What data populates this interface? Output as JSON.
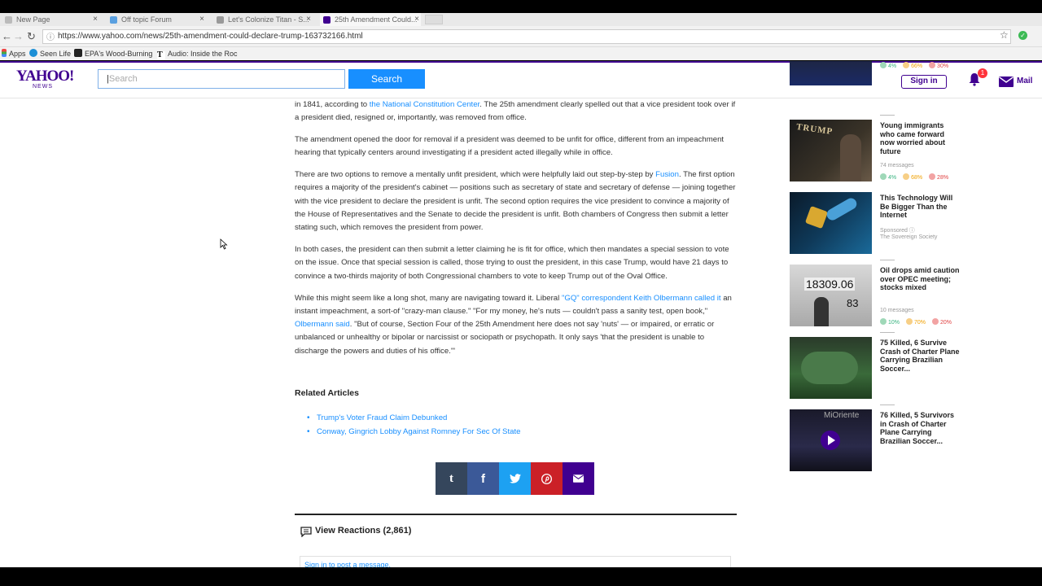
{
  "tabs": [
    {
      "title": "New Page",
      "color": "#bbbbbb"
    },
    {
      "title": "Off topic Forum",
      "color": "#5aa0e0"
    },
    {
      "title": "Let's Colonize Titan - S...",
      "color": "#999999"
    },
    {
      "title": "25th Amendment Could...",
      "color": "#400090"
    }
  ],
  "url": "https://www.yahoo.com/news/25th-amendment-could-declare-trump-163732166.html",
  "bookmarks": [
    "Apps",
    "Seen Life",
    "EPA's Wood-Burning",
    "Audio: Inside the Roc"
  ],
  "header": {
    "logo": "YAHOO!",
    "logo_sub": "NEWS",
    "search_placeholder": "Search",
    "search_button": "Search",
    "signin": "Sign in",
    "notifications": "1",
    "mail": "Mail"
  },
  "article": {
    "p1_a": "in 1841, according to ",
    "p1_link": "the National Constitution Center",
    "p1_b": ". The 25th amendment clearly spelled out that a vice president took over if a president died, resigned or, importantly, was removed from office.",
    "p2": "The amendment opened the door for removal if a president was deemed to be unfit for office, different from an impeachment hearing that typically centers around investigating if a president acted illegally while in office.",
    "p3_a": "There are two options to remove a mentally unfit president, which were helpfully laid out step-by-step by ",
    "p3_link": "Fusion",
    "p3_b": ". The first option requires a majority of the president's cabinet — positions such as secretary of state and secretary of defense — joining together with the vice president to declare the president is unfit. The second option requires the vice president to convince a majority of the House of Representatives and the Senate to decide the president is unfit. Both chambers of Congress then submit a letter stating such, which removes the president from power.",
    "p4": "In both cases, the president can then submit a letter claiming he is fit for office, which then mandates a special session to vote on the issue. Once that special session is called, those trying to oust the president, in this case Trump, would have 21 days to convince a two-thirds majority of both Congressional chambers to vote to keep Trump out of the Oval Office.",
    "p5_a": "While this might seem like a long shot, many are navigating toward it. Liberal ",
    "p5_link1": "\"GQ\" correspondent Keith Olbermann called it",
    "p5_b": " an instant impeachment, a sort-of \"crazy-man clause.\" \"For my money, he's nuts — couldn't pass a sanity test, open book,\" ",
    "p5_link2": "Olbermann said",
    "p5_c": ". \"But of course, Section Four of the 25th Amendment here does not say 'nuts' — or impaired, or erratic or unbalanced or unhealthy or bipolar or narcissist or sociopath or psychopath. It only says 'that the president is unable to discharge the powers and duties of his office.'\""
  },
  "related": {
    "title": "Related Articles",
    "items": [
      "Trump's Voter Fraud Claim Debunked",
      "Conway, Gingrich Lobby Against Romney For Sec Of State"
    ]
  },
  "share": [
    {
      "icon": "tumblr-icon",
      "glyph": "t",
      "color": "#35465c"
    },
    {
      "icon": "facebook-icon",
      "glyph": "f",
      "color": "#3b5998"
    },
    {
      "icon": "twitter-icon",
      "glyph": "",
      "color": "#1da1f2"
    },
    {
      "icon": "pinterest-icon",
      "glyph": "",
      "color": "#cb2027"
    },
    {
      "icon": "mail-icon",
      "glyph": "",
      "color": "#400090"
    }
  ],
  "reactions": {
    "label": "View Reactions (2,861)",
    "signin_prompt": "Sign in to post a message."
  },
  "sidebar": [
    {
      "title": "",
      "meta": "",
      "rx": [
        "4%",
        "66%",
        "30%"
      ]
    },
    {
      "title": "Young immigrants who came forward now worried about future",
      "meta": "74 messages",
      "rx": [
        "4%",
        "68%",
        "28%"
      ]
    },
    {
      "title": "This Technology Will Be Bigger Than the Internet",
      "meta": "Sponsored",
      "sponsor": "The Sovereign Society",
      "rx": []
    },
    {
      "title": "Oil drops amid caution over OPEC meeting; stocks mixed",
      "meta": "10 messages",
      "rx": [
        "10%",
        "70%",
        "20%"
      ],
      "thumb_text1": "18309.06",
      "thumb_text2": "83"
    },
    {
      "title": "75 Killed, 6 Survive Crash of Charter Plane Carrying Brazilian Soccer...",
      "meta": "",
      "rx": []
    },
    {
      "title": "76 Killed, 5 Survivors in Crash of Charter Plane Carrying Brazilian Soccer...",
      "meta": "",
      "rx": [],
      "thumb_text1": "MiOriente"
    }
  ]
}
